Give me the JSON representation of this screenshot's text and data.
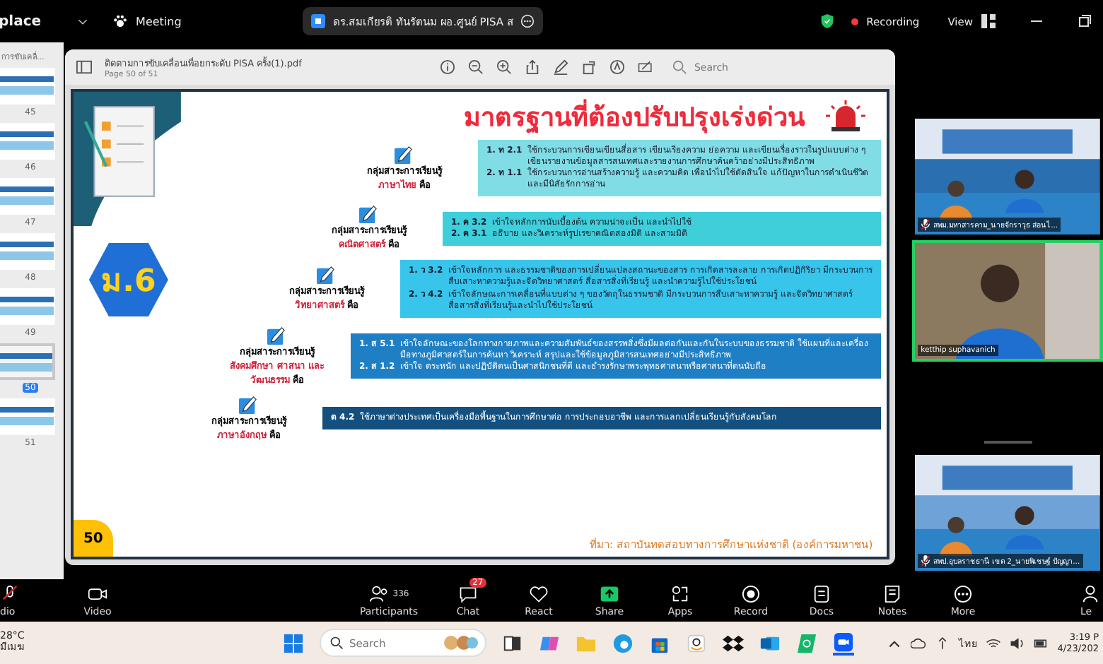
{
  "meeting_bar": {
    "app_name": "place",
    "meeting_label": "Meeting",
    "share_title": "ดร.สมเกียรติ ทันรัตนม ผอ.ศูนย์ PISA ส",
    "recording_label": "Recording",
    "view_label": "View"
  },
  "pdf_sidebar": {
    "title": "การขับเคลื่...",
    "pages": [
      {
        "number": "45",
        "selected": false
      },
      {
        "number": "46",
        "selected": false
      },
      {
        "number": "47",
        "selected": false
      },
      {
        "number": "48",
        "selected": false
      },
      {
        "number": "49",
        "selected": false
      },
      {
        "number": "50",
        "selected": true
      },
      {
        "number": "51",
        "selected": false
      }
    ]
  },
  "pdf_viewer": {
    "file_name": "ติดตามการขับเคลื่อนเพื่อยกระดับ PISA ครั้ง(1).pdf",
    "page_info": "Page 50 of 51",
    "search": {
      "placeholder": "Search"
    }
  },
  "slide": {
    "title": "มาตรฐานที่ต้องปรับปรุงเร่งด่วน",
    "grade_badge": "ม.6",
    "page_number": "50",
    "source": "ที่มา: สถาบันทดสอบทางการศึกษาแห่งชาติ (องค์การมหาชน)",
    "groups": [
      {
        "label": "กลุ่มสาระการเรียนรู้",
        "subject": "ภาษาไทย",
        "suffix": "คือ",
        "color": "#80dde5",
        "items": [
          {
            "code": "1. ท 2.1",
            "text": "ใช้กระบวนการเขียนเขียนสื่อสาร เขียนเรียงความ ย่อความ และเขียนเรื่องราวในรูปแบบต่าง ๆ เขียนรายงานข้อมูลสารสนเทศและรายงานการศึกษาค้นคว้าอย่างมีประสิทธิภาพ"
          },
          {
            "code": "2. ท 1.1",
            "text": "ใช้กระบวนการอ่านสร้างความรู้ และความคิด เพื่อนำไปใช้ตัดสินใจ แก้ปัญหาในการดำเนินชีวิต และมีนิสัยรักการอ่าน"
          }
        ]
      },
      {
        "label": "กลุ่มสาระการเรียนรู้",
        "subject": "คณิตศาสตร์",
        "suffix": "คือ",
        "color": "#3ecfdb",
        "items": [
          {
            "code": "1. ค 3.2",
            "text": "เข้าใจหลักการนับเบื้องต้น ความน่าจะเป็น และนำไปใช้"
          },
          {
            "code": "2. ค 3.1",
            "text": "อธิบาย และวิเคราะห์รูปเรขาคณิตสองมิติ และสามมิติ"
          }
        ]
      },
      {
        "label": "กลุ่มสาระการเรียนรู้",
        "subject": "วิทยาศาสตร์",
        "suffix": "คือ",
        "color": "#38c5ec",
        "items": [
          {
            "code": "1. ว 3.2",
            "text": "เข้าใจหลักการ และธรรมชาติของการเปลี่ยนแปลงสถานะของสาร การเกิดสารละลาย การเกิดปฏิกิริยา มีกระบวนการสืบเสาะหาความรู้และจิตวิทยาศาสตร์ สื่อสารสิ่งที่เรียนรู้ และนำความรู้ไปใช้ประโยชน์"
          },
          {
            "code": "2. ว 4.2",
            "text": "เข้าใจลักษณะการเคลื่อนที่แบบต่าง ๆ ของวัตถุในธรรมชาติ มีกระบวนการสืบเสาะหาความรู้ และจิตวิทยาศาสตร์สื่อสารสิ่งที่เรียนรู้และนำไปใช้ประโยชน์"
          }
        ]
      },
      {
        "label": "กลุ่มสาระการเรียนรู้",
        "subject": "สังคมศึกษา ศาสนา และวัฒนธรรม",
        "suffix": "คือ",
        "color": "#1f7fc4",
        "items": [
          {
            "code": "1. ส 5.1",
            "text": "เข้าใจลักษณะของโลกทางกายภาพและความสัมพันธ์ของสรรพสิ่งซึ่งมีผลต่อกันและกันในระบบของธรรมชาติ ใช้แผนที่และเครื่องมือทางภูมิศาสตร์ในการค้นหา วิเคราะห์ สรุปและใช้ข้อมูลภูมิสารสนเทศอย่างมีประสิทธิภาพ"
          },
          {
            "code": "2. ส 1.2",
            "text": "เข้าใจ ตระหนัก และปฏิบัติตนเป็นศาสนิกชนที่ดี และธำรงรักษาพระพุทธศาสนาหรือศาสนาที่ตนนับถือ"
          }
        ]
      },
      {
        "label": "กลุ่มสาระการเรียนรู้",
        "subject": "ภาษาอังกฤษ",
        "suffix": "คือ",
        "color": "#13507f",
        "items": [
          {
            "code": "ต 4.2",
            "text": "ใช้ภาษาต่างประเทศเป็นเครื่องมือพื้นฐานในการศึกษาต่อ การประกอบอาชีพ และการแลกเปลี่ยนเรียนรู้กับสังคมโลก"
          }
        ]
      }
    ]
  },
  "videos": [
    {
      "name": "สพม.มหาสารคาม_นายจักราวุธ ส่อนไ...",
      "muted": true,
      "active": false
    },
    {
      "name": "ketthip suphavanich",
      "muted": false,
      "active": true
    },
    {
      "name": "สพป.อุบลราชธานี เขต 2_นายพิเชษฐ์ ปัญญา...",
      "muted": true,
      "active": false
    }
  ],
  "toolbar": [
    {
      "kind": "audio",
      "label": "dio"
    },
    {
      "kind": "video",
      "label": "Video"
    },
    {
      "kind": "participants",
      "label": "Participants",
      "count": "336"
    },
    {
      "kind": "chat",
      "label": "Chat",
      "badge": "27"
    },
    {
      "kind": "react",
      "label": "React"
    },
    {
      "kind": "share",
      "label": "Share"
    },
    {
      "kind": "apps",
      "label": "Apps"
    },
    {
      "kind": "record",
      "label": "Record"
    },
    {
      "kind": "docs",
      "label": "Docs"
    },
    {
      "kind": "notes",
      "label": "Notes"
    },
    {
      "kind": "more",
      "label": "More"
    },
    {
      "kind": "leave",
      "label": "Le"
    }
  ],
  "taskbar": {
    "temperature": "28°C",
    "condition": "มีเมฆ",
    "search": {
      "placeholder": "Search"
    },
    "language": "ไทย",
    "time": "3:19 P",
    "date": "4/23/202"
  }
}
